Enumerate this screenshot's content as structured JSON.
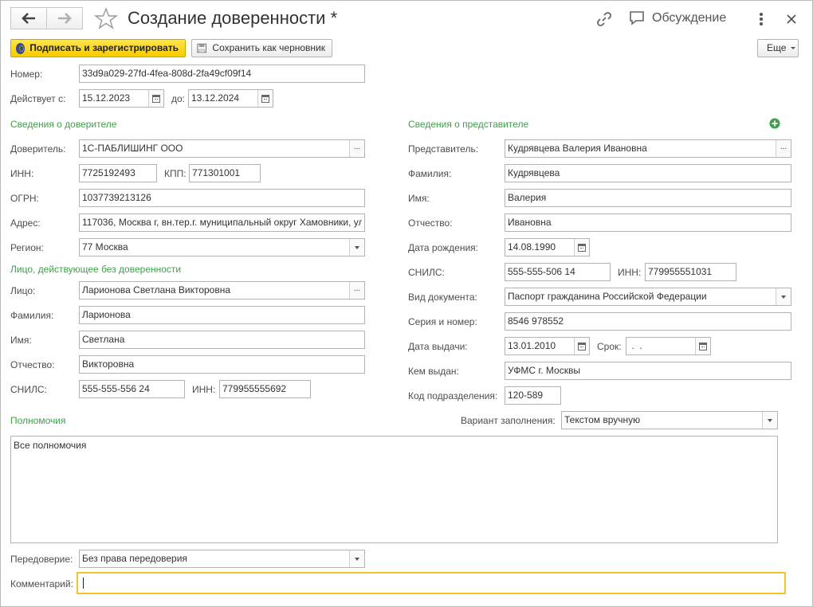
{
  "window": {
    "title": "Создание доверенности *",
    "discussion": "Обсуждение"
  },
  "toolbar": {
    "sign_register": "Подписать и зарегистрировать",
    "save_draft": "Сохранить как черновник",
    "more": "Еще"
  },
  "header": {
    "number_label": "Номер:",
    "number_value": "33d9a029-27fd-4fea-808d-2fa49cf09f14",
    "valid_from_label": "Действует с:",
    "valid_from": "15.12.2023",
    "valid_to_label": "до:",
    "valid_to": "13.12.2024"
  },
  "principal": {
    "section": "Сведения о доверителе",
    "principal_label": "Доверитель:",
    "principal_value": "1С-ПАБЛИШИНГ ООО",
    "inn_label": "ИНН:",
    "inn_value": "7725192493",
    "kpp_label": "КПП:",
    "kpp_value": "771301001",
    "ogrn_label": "ОГРН:",
    "ogrn_value": "1037739213126",
    "address_label": "Адрес:",
    "address_value": "117036, Москва г, вн.тер.г. муниципальный округ Хамовники, ул",
    "region_label": "Регион:",
    "region_value": "77 Москва"
  },
  "acting_person": {
    "section": "Лицо, действующее без доверенности",
    "person_label": "Лицо:",
    "person_value": "Ларионова Светлана Викторовна",
    "last_name_label": "Фамилия:",
    "last_name_value": "Ларионова",
    "first_name_label": "Имя:",
    "first_name_value": "Светлана",
    "patronymic_label": "Отчество:",
    "patronymic_value": "Викторовна",
    "snils_label": "СНИЛС:",
    "snils_value": "555-555-556 24",
    "inn_label": "ИНН:",
    "inn_value": "779955555692"
  },
  "representative": {
    "section": "Сведения о представителе",
    "rep_label": "Представитель:",
    "rep_value": "Кудрявцева Валерия Ивановна",
    "last_name_label": "Фамилия:",
    "last_name_value": "Кудрявцева",
    "first_name_label": "Имя:",
    "first_name_value": "Валерия",
    "patronymic_label": "Отчество:",
    "patronymic_value": "Ивановна",
    "birth_label": "Дата рождения:",
    "birth_value": "14.08.1990",
    "snils_label": "СНИЛС:",
    "snils_value": "555-555-506 14",
    "inn_label": "ИНН:",
    "inn_value": "779955551031",
    "doc_type_label": "Вид документа:",
    "doc_type_value": "Паспорт гражданина Российской Федерации",
    "series_label": "Серия и номер:",
    "series_value": "8546 978552",
    "issue_date_label": "Дата выдачи:",
    "issue_date_value": "13.01.2010",
    "term_label": "Срок:",
    "term_value": " .  .",
    "issued_by_label": "Кем выдан:",
    "issued_by_value": "УФМС г. Москвы",
    "dept_code_label": "Код подразделения:",
    "dept_code_value": "120-589"
  },
  "powers": {
    "section": "Полномочия",
    "fill_variant_label": "Вариант заполнения:",
    "fill_variant_value": "Текстом вручную",
    "text": "Все полномочия"
  },
  "footer": {
    "redelegation_label": "Передоверие:",
    "redelegation_value": "Без права передоверия",
    "comment_label": "Комментарий:",
    "comment_value": ""
  },
  "colors": {
    "accent_green": "#3ea14a",
    "primary_yellow": "#f5cc00",
    "focus_border": "#f2c32c"
  }
}
